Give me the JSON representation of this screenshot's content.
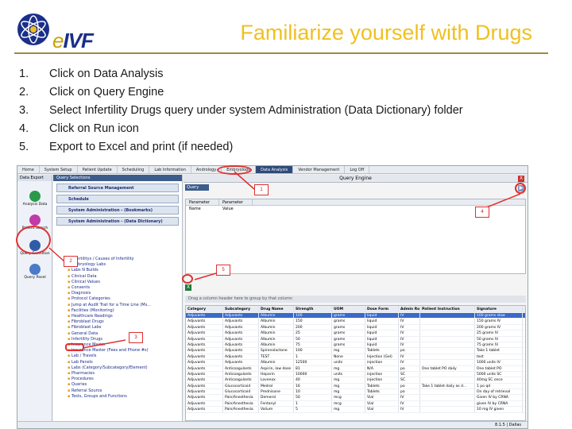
{
  "header": {
    "logo_prefix": "e",
    "logo_text": "IVF",
    "title": "Familiarize yourself with Drugs"
  },
  "steps": [
    {
      "num": "1.",
      "text": "Click on Data Analysis"
    },
    {
      "num": "2.",
      "text": "Click on Query Engine"
    },
    {
      "num": "3.",
      "text": "Select Infertility Drugs query under system Administration (Data Dictionary) folder"
    },
    {
      "num": "4.",
      "text": "Click on Run icon"
    },
    {
      "num": "5.",
      "text": "Export to Excel and print (if needed)"
    }
  ],
  "app": {
    "menu": [
      "Home",
      "System Setup",
      "Patient Update",
      "Scheduling",
      "Lab Information",
      "Andrology",
      "Embryology",
      "Data Analysis",
      "Vendor Management",
      "Log Off"
    ],
    "active_menu": "Data Analysis",
    "left_nav": {
      "header": "Data Export",
      "items": [
        "Analysis Data",
        "Patient Search",
        "Query Execution",
        "Query Panel"
      ]
    },
    "tree": {
      "header": "Query Selections",
      "sections": [
        "Referral Source Management",
        "Schedule",
        "System Administration - (Bookmarks)",
        "System Administration - (Data Dictionary)"
      ],
      "items": [
        "Infertilitys / Causes of Infertility",
        "Embryology Labs",
        "Labs N Builds",
        "Clinical Data",
        "Clinical Values",
        "Consents",
        "Diagnosis",
        "Protocol Categories",
        "Jump at Audit Trail for a Time Line (Ms...",
        "Facilities (Monitoring)",
        "Healthcare Readings",
        "Fibroblast Drugs",
        "Fibroblast Labs",
        "General Data",
        "Infertility Drugs",
        "Insurance Master",
        "Insurance Master (Fees and Phone #s)",
        "Lab / Travels",
        "Lab Panels",
        "Labs (Category/Subcategory/Element)",
        "Pharmacies",
        "Procedures",
        "Queries",
        "Referral Source",
        "Tests, Groups and Functions"
      ]
    },
    "query_engine": {
      "window_title": "Query Engine",
      "close_label": "X",
      "query_tab": "Query",
      "run_icon": "run-icon",
      "param_headers": [
        "Parameter Name",
        "Parameter Value"
      ],
      "export_icon": "excel-export-icon",
      "group_hint": "Drag a column header here to group by that column",
      "columns": [
        "Category",
        "Subcategory",
        "Drug Name",
        "Strength",
        "UOM",
        "Dose Form",
        "Admin Route",
        "Patient Instruction",
        "Signature"
      ],
      "rows": [
        [
          "Adjuvants",
          "Adjuvants",
          "Albumin",
          "100",
          "grams",
          "liquid",
          "IV",
          "",
          "100 grams slow"
        ],
        [
          "Adjuvants",
          "Adjuvants",
          "Albumin",
          "150",
          "grams",
          "liquid",
          "IV",
          "",
          "150 grams IV"
        ],
        [
          "Adjuvants",
          "Adjuvants",
          "Albumin",
          "200",
          "grams",
          "liquid",
          "IV",
          "",
          "200 grams IV"
        ],
        [
          "Adjuvants",
          "Adjuvants",
          "Albumin",
          "25",
          "grams",
          "liquid",
          "IV",
          "",
          "25 grams IV"
        ],
        [
          "Adjuvants",
          "Adjuvants",
          "Albumin",
          "50",
          "grams",
          "liquid",
          "IV",
          "",
          "50 grams IV"
        ],
        [
          "Adjuvants",
          "Adjuvants",
          "Albumin",
          "75",
          "grams",
          "liquid",
          "IV",
          "",
          "75 grams IV"
        ],
        [
          "Adjuvants",
          "Adjuvants",
          "Spironolactone",
          "100",
          "mg",
          "Tablets",
          "po",
          "",
          "Take 1 tablet"
        ],
        [
          "Adjuvants",
          "Adjuvants",
          "TEST",
          "1",
          "None",
          "Injection (Gel)",
          "IV",
          "",
          "test"
        ],
        [
          "Adjuvants",
          "Adjuvants",
          "Albumin",
          "12500",
          "units",
          "injection",
          "IV",
          "",
          "1000 units IV"
        ],
        [
          "Adjuvants",
          "Anticoagulants",
          "Aspirin, low dose",
          "81",
          "mg",
          "N/A",
          "po",
          "One tablet PO daily",
          "One tablet PO"
        ],
        [
          "Adjuvants",
          "Anticoagulants",
          "Heparin",
          "10000",
          "units",
          "injection",
          "SC",
          "",
          "5000 units SC"
        ],
        [
          "Adjuvants",
          "Anticoagulants",
          "Lovenox",
          "40",
          "mg",
          "injection",
          "SC",
          "",
          "40mg SC once"
        ],
        [
          "Adjuvants",
          "Glucocorticoid",
          "Medrol",
          "16",
          "mg",
          "Tablets",
          "po",
          "Take 1 tablet daily as d...",
          "1 po qd"
        ],
        [
          "Adjuvants",
          "Glucocorticoid",
          "Prednisone",
          "10",
          "mg",
          "Tablets",
          "po",
          "",
          "On day of retrieval"
        ],
        [
          "Adjuvants",
          "Pain/Anesthesia",
          "Demerol",
          "50",
          "mcg",
          "Vial",
          "IV",
          "",
          "Given IV by CRNA"
        ],
        [
          "Adjuvants",
          "Pain/Anesthesia",
          "Fentanyl",
          "1",
          "mcg",
          "Vial",
          "IV",
          "",
          "given IV by CRNA"
        ],
        [
          "Adjuvants",
          "Pain/Anesthesia",
          "Valium",
          "5",
          "mg",
          "Vial",
          "IV",
          "",
          "10 mg IV given"
        ]
      ],
      "status_text": "8.1.5 | Dallas"
    },
    "callouts": [
      "1",
      "2",
      "3",
      "4",
      "5"
    ]
  }
}
